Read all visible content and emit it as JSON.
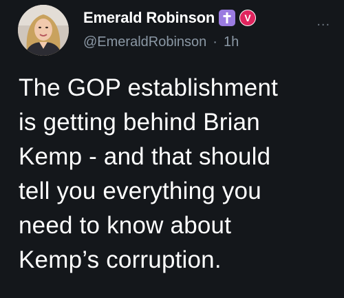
{
  "author": {
    "display_name": "Emerald Robinson",
    "handle": "@EmeraldRobinson",
    "separator": "·",
    "timestamp": "1h",
    "badges": [
      "cross-icon",
      "v-badge-icon"
    ],
    "badge_v_text": "V"
  },
  "more_label": "...",
  "tweet": {
    "lines": [
      "The GOP establishment",
      "is getting behind Brian",
      "Kemp - and that should",
      "tell you everything you",
      "need to know about",
      "Kemp’s corruption."
    ]
  },
  "colors": {
    "background": "#14171b",
    "text_primary": "#ffffff",
    "text_secondary": "#8b98a5",
    "cross_badge": "#9a7be0",
    "v_badge": "#e0245e"
  }
}
